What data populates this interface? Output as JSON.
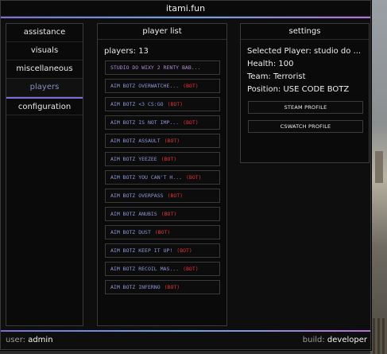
{
  "window": {
    "title": "itami.fun"
  },
  "colors": {
    "accent": "#7b6fd6",
    "bot": "#e0303a",
    "player_text": "#8e96d8"
  },
  "sidebar": {
    "items": [
      {
        "label": "assistance"
      },
      {
        "label": "visuals"
      },
      {
        "label": "miscellaneous"
      },
      {
        "label": "players"
      },
      {
        "label": "configuration"
      }
    ],
    "active": "players"
  },
  "player_list": {
    "header": "player list",
    "count_text": "players: 13",
    "players": [
      {
        "name": "STUDIO DO WIXY 2 RENTY BAB...",
        "tag": ""
      },
      {
        "name": "AIM BOTZ OVERWATCHE...",
        "tag": "(BOT)"
      },
      {
        "name": "AIM BOTZ <3 CS:GO",
        "tag": "(BOT)"
      },
      {
        "name": "AIM BOTZ IS NOT IMP...",
        "tag": "(BOT)"
      },
      {
        "name": "AIM BOTZ ASSAULT",
        "tag": "(BOT)"
      },
      {
        "name": "AIM BOTZ YEEZEE",
        "tag": "(BOT)"
      },
      {
        "name": "AIM BOTZ YOU CAN'T H...",
        "tag": "(BOT)"
      },
      {
        "name": "AIM BOTZ OVERPASS",
        "tag": "(BOT)"
      },
      {
        "name": "AIM BOTZ ANUBIS",
        "tag": "(BOT)"
      },
      {
        "name": "AIM BOTZ DUST",
        "tag": "(BOT)"
      },
      {
        "name": "AIM BOTZ KEEP IT UP!",
        "tag": "(BOT)"
      },
      {
        "name": "AIM BOTZ RECOIL MAS...",
        "tag": "(BOT)"
      },
      {
        "name": "AIM BOTZ INFERNO",
        "tag": "(BOT)"
      }
    ]
  },
  "settings": {
    "header": "settings",
    "selected_player": "Selected Player: studio do ...",
    "health": "Health: 100",
    "team": "Team: Terrorist",
    "position": "Position: USE CODE BOTZ",
    "buttons": {
      "steam": "STEAM PROFILE",
      "cswatch": "CSWATCH PROFILE"
    }
  },
  "footer": {
    "user_label": "user:",
    "user_value": "admin",
    "build_label": "build:",
    "build_value": "developer"
  }
}
